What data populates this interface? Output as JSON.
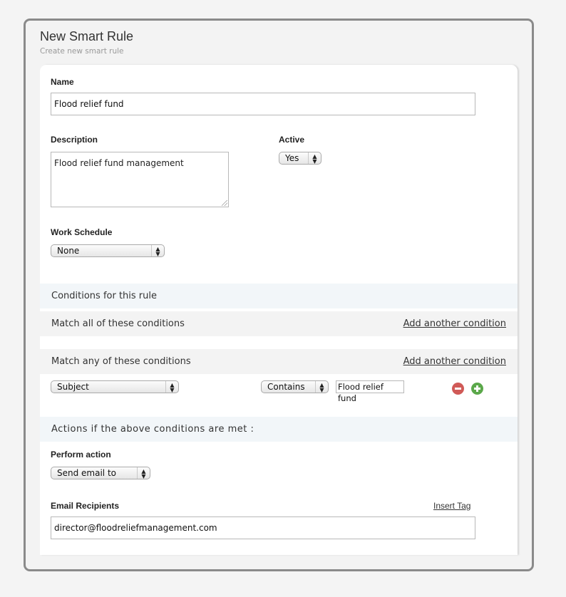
{
  "header": {
    "title": "New Smart Rule",
    "subtitle": "Create new smart rule"
  },
  "form": {
    "name": {
      "label": "Name",
      "value": "Flood relief fund"
    },
    "description": {
      "label": "Description",
      "value": "Flood relief fund management"
    },
    "active": {
      "label": "Active",
      "value": "Yes"
    },
    "work_schedule": {
      "label": "Work Schedule",
      "value": "None"
    }
  },
  "conditions": {
    "section_title": "Conditions for this rule",
    "match_all": {
      "label": "Match all of these conditions",
      "add_link": "Add another condition"
    },
    "match_any": {
      "label": "Match any of these conditions",
      "add_link": "Add another condition",
      "rows": [
        {
          "field": "Subject",
          "operator": "Contains",
          "value": "Flood relief fund",
          "remove_icon": "minus-circle-icon",
          "add_icon": "plus-circle-icon"
        }
      ]
    }
  },
  "actions": {
    "section_title": "Actions if the above conditions are met :",
    "perform_action": {
      "label": "Perform action",
      "value": "Send email to"
    },
    "email_recipients": {
      "label": "Email Recipients",
      "insert_tag_link": "Insert Tag",
      "value": "director@floodreliefmanagement.com"
    }
  },
  "colors": {
    "remove": "#d05a57",
    "add": "#5ba84a",
    "section_band": "#f2f6f9"
  }
}
